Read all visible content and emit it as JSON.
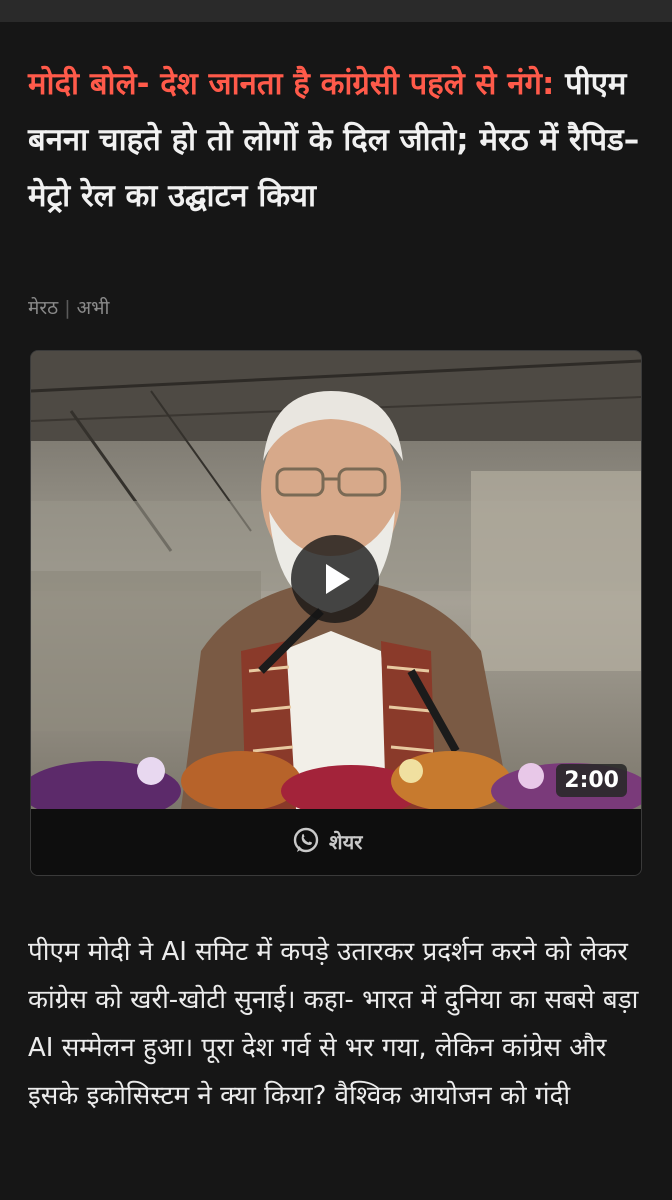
{
  "article": {
    "headline_red": "मोदी बोले- देश जानता है कांग्रेसी पहले से नंगे:",
    "headline_rest": " पीएम बनना चाहते हो तो लोगों के दिल जीतो; मेरठ में रैपिड–मेट्रो रेल का उद्घाटन किया",
    "location": "मेरठ",
    "time": "अभी",
    "accent_color": "#ff5a4a"
  },
  "video": {
    "duration": "2:00",
    "share_label": "शेयर",
    "play_icon": "play-icon",
    "share_icon": "whatsapp-icon"
  },
  "body": {
    "paragraph": "पीएम मोदी ने AI समिट में कपड़े उतारकर प्रदर्शन करने को लेकर कांग्रेस को खरी-खोटी सुनाई। कहा- भारत में दुनिया का सबसे बड़ा AI सम्मेलन हुआ। पूरा देश गर्व से भर गया, लेकिन कांग्रेस और इसके इकोसिस्टम ने क्या किया? वैश्विक आयोजन को गंदी"
  }
}
